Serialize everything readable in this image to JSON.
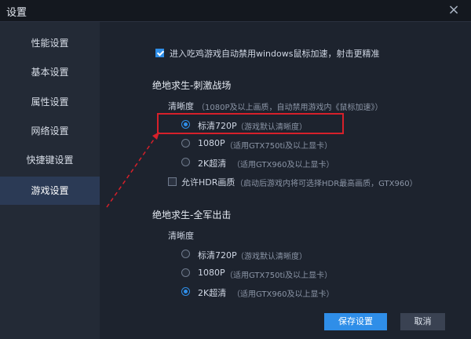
{
  "window": {
    "title": "设置",
    "close_icon": "×"
  },
  "sidebar": {
    "items": [
      {
        "label": "性能设置",
        "active": false
      },
      {
        "label": "基本设置",
        "active": false
      },
      {
        "label": "属性设置",
        "active": false
      },
      {
        "label": "网络设置",
        "active": false
      },
      {
        "label": "快捷键设置",
        "active": false
      },
      {
        "label": "游戏设置",
        "active": true
      }
    ]
  },
  "top_option": {
    "label": "进入吃鸡游戏自动禁用windows鼠标加速，射击更精准",
    "checked": true
  },
  "section1": {
    "title": "绝地求生-刺激战场",
    "clarity_label": "清晰度",
    "clarity_hint": "（1080P及以上画质，自动禁用游戏内《鼠标加速》）",
    "options": [
      {
        "label": "标清720P",
        "hint": "（游戏默认清晰度）",
        "selected": true
      },
      {
        "label": "1080P",
        "hint": "（适用GTX750ti及以上显卡）",
        "selected": false
      },
      {
        "label": "2K超清",
        "hint": "（适用GTX960及以上显卡）",
        "selected": false
      }
    ],
    "hdr": {
      "label": "允许HDR画质",
      "hint": "（启动后游戏内将可选择HDR最高画质，GTX960）",
      "checked": false
    }
  },
  "section2": {
    "title": "绝地求生-全军出击",
    "clarity_label": "清晰度",
    "options": [
      {
        "label": "标清720P",
        "hint": "（游戏默认清晰度）",
        "selected": false
      },
      {
        "label": "1080P",
        "hint": "（适用GTX750ti及以上显卡）",
        "selected": false
      },
      {
        "label": "2K超清",
        "hint": "（适用GTX960及以上显卡）",
        "selected": true
      }
    ]
  },
  "buttons": {
    "save": "保存设置",
    "cancel": "取消"
  },
  "colors": {
    "accent": "#2f8ee8",
    "annotation": "#d6202a"
  }
}
